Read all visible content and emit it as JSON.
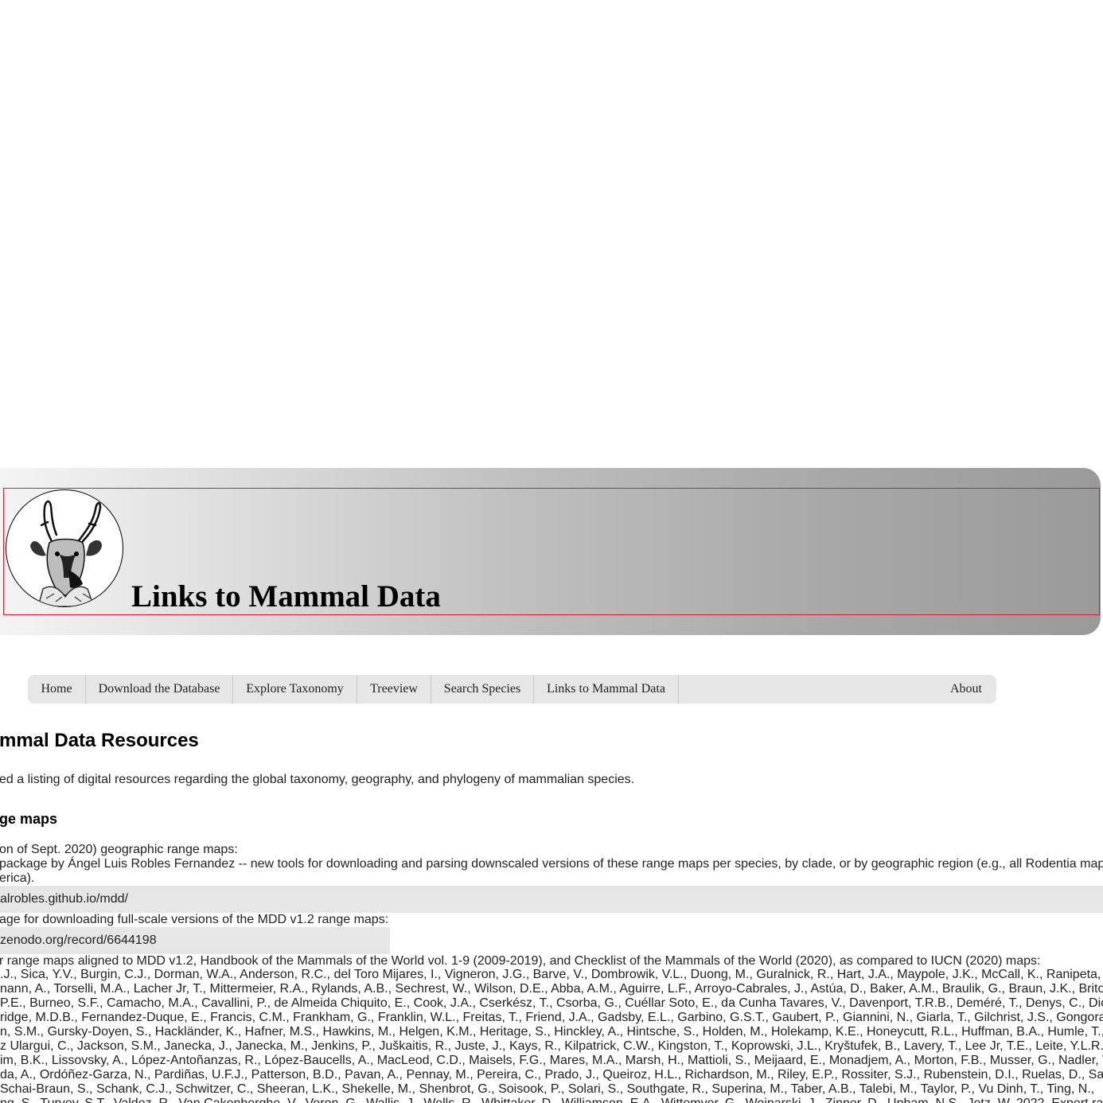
{
  "header": {
    "title": "Links to Mammal Data"
  },
  "nav": {
    "items": [
      {
        "label": "Home"
      },
      {
        "label": "Download the Database"
      },
      {
        "label": "Explore Taxonomy"
      },
      {
        "label": "Treeview"
      },
      {
        "label": "Search Species"
      },
      {
        "label": "Links to Mammal Data"
      }
    ],
    "about": "About"
  },
  "main": {
    "heading": "mmal Data Resources",
    "intro": "ed a listing of digital resources regarding the global taxonomy, geography, and phylogeny of mammalian species.",
    "section_heading": "ge maps",
    "line1": "on of Sept. 2020) geographic range maps:",
    "line2": "package by Ángel Luis Robles Fernandez -- new tools for downloading and parsing downscaled versions of these range maps per species, by clade, or by geographic region (e.g., all Rodentia maps",
    "line3": "erica).",
    "link1": "alrobles.github.io/mdd/",
    "line4": "age for downloading full-scale versions of the MDD v1.2 range maps:",
    "link2": "zenodo.org/record/6644198",
    "line5": "r range maps aligned to MDD v1.2, Handbook of the Mammals of the World vol. 1-9 (2009-2019), and Checklist of the Mammals of the World (2020), as compared to IUCN (2020) maps:",
    "refs": [
      ".J., Sica, Y.V., Burgin, C.J., Dorman, W.A., Anderson, R.C., del Toro Mijares, I., Vigneron, J.G., Barve, V., Dombrowik, V.L., Duong, M., Guralnick, R., Hart, J.A., Maypole, J.K., McCall, K., Ranipeta, A",
      "nann, A., Torselli, M.A., Lacher Jr, T., Mittermeier, R.A., Rylands, A.B., Sechrest, W., Wilson, D.E., Abba, A.M., Aguirre, L.F., Arroyo-Cabrales, J., Astúa, D., Baker, A.M., Braulik, G., Braun, J.K., Brito",
      "P.E., Burneo, S.F., Camacho, M.A., Cavallini, P., de Almeida Chiquito, E., Cook, J.A., Cserkész, T., Csorba, G., Cuéllar Soto, E., da Cunha Tavares, V., Davenport, T.R.B., Deméré, T., Denys, C., Dick",
      "ridge, M.D.B., Fernandez-Duque, E., Francis, C.M., Frankham, G., Franklin, W.L., Freitas, T., Friend, J.A., Gadsby, E.L., Garbino, G.S.T., Gaubert, P., Giannini, N., Giarla, T., Gilchrist, J.S., Gongora",
      "n, S.M., Gursky-Doyen, S., Hackländer, K., Hafner, M.S., Hawkins, M., Helgen, K.M., Heritage, S., Hinckley, A., Hintsche, S., Holden, M., Holekamp, K.E., Honeycutt, R.L., Huffman, B.A., Humle, T.,",
      "z Ulargui, C., Jackson, S.M., Janecka, J., Janecka, M., Jenkins, P., Juškaitis, R., Juste, J., Kays, R., Kilpatrick, C.W., Kingston, T., Koprowski, J.L., Kryštufek, B., Lavery, T., Lee Jr, T.E., Leite, Y.L.R.",
      "im, B.K., Lissovsky, A., López-Antoñanzas, R., López-Baucells, A., MacLeod, C.D., Maisels, F.G., Mares, M.A., Marsh, H., Mattioli, S., Meijaard, E., Monadjem, A., Morton, F.B., Musser, G., Nadler, T",
      "da, A., Ordóñez-Garza, N., Pardiñas, U.F.J., Patterson, B.D., Pavan, A., Pennay, M., Pereira, C., Prado, J., Queiroz, H.L., Richardson, M., Riley, E.P., Rossiter, S.J., Rubenstein, D.I., Ruelas, D., Sa",
      "Schai-Braun, S., Schank, C.J., Schwitzer, C., Sheeran, L.K., Shekelle, M., Shenbrot, G., Soisook, P., Solari, S., Southgate, R., Superina, M., Taber, A.B., Talebi, M., Taylor, P., Vu Dinh, T., Ting, N.,",
      "ng, S., Turvey, S.T., Valdez, R., Van Cakenberghe, V., Veron, G., Wallis, J., Wells, R., Whittaker, D., Williamson, E.A., Wittemyer, G., Woinarski, J., Zinner, D., Upham, N.S., Jetz, W. 2022. Expert ra"
    ]
  }
}
